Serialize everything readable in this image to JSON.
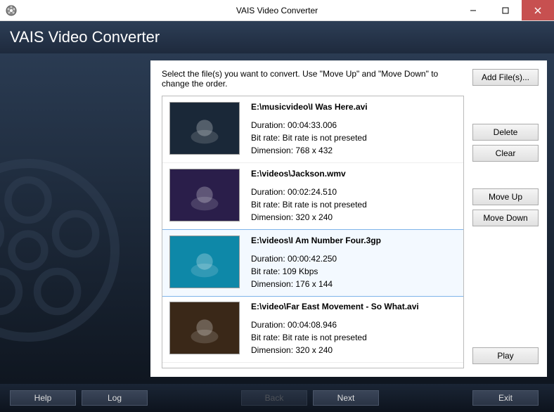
{
  "window": {
    "title": "VAIS Video Converter"
  },
  "header": {
    "title": "VAIS Video Converter"
  },
  "instruction": "Select the file(s) you want to convert. Use \"Move Up\" and \"Move Down\" to change the order.",
  "files": [
    {
      "path": "E:\\musicvideo\\I Was Here.avi",
      "duration": "Duration: 00:04:33.006",
      "bitrate": "Bit rate: Bit rate is not preseted",
      "dimension": "Dimension: 768 x 432",
      "selected": false,
      "thumb_bg": "#1a2838"
    },
    {
      "path": "E:\\videos\\Jackson.wmv",
      "duration": "Duration: 00:02:24.510",
      "bitrate": "Bit rate: Bit rate is not preseted",
      "dimension": "Dimension: 320 x 240",
      "selected": false,
      "thumb_bg": "#2a1e4a"
    },
    {
      "path": "E:\\videos\\I Am Number Four.3gp",
      "duration": "Duration: 00:00:42.250",
      "bitrate": "Bit rate: 109 Kbps",
      "dimension": "Dimension: 176 x 144",
      "selected": true,
      "thumb_bg": "#0e88a8"
    },
    {
      "path": "E:\\video\\Far East Movement - So What.avi",
      "duration": "Duration: 00:04:08.946",
      "bitrate": "Bit rate: Bit rate is not preseted",
      "dimension": "Dimension: 320 x 240",
      "selected": false,
      "thumb_bg": "#3a2818"
    }
  ],
  "buttons": {
    "add_files": "Add File(s)...",
    "delete": "Delete",
    "clear": "Clear",
    "move_up": "Move Up",
    "move_down": "Move Down",
    "play": "Play"
  },
  "footer": {
    "help": "Help",
    "log": "Log",
    "back": "Back",
    "next": "Next",
    "exit": "Exit"
  }
}
